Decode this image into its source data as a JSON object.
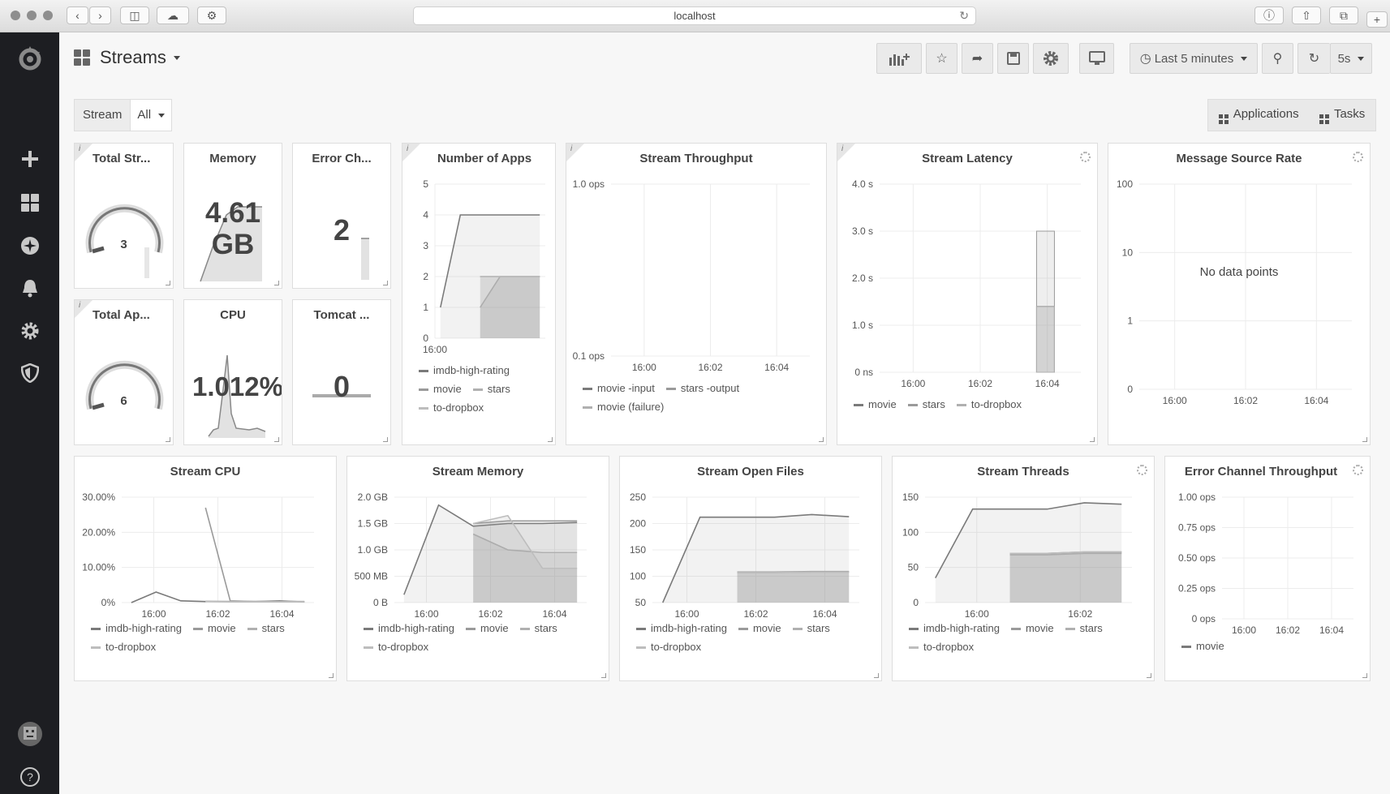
{
  "browser": {
    "url": "localhost"
  },
  "dashboard": {
    "title": "Streams"
  },
  "toolbar": {
    "time_range": "Last 5 minutes",
    "refresh": "5s"
  },
  "variables": {
    "label": "Stream",
    "value": "All"
  },
  "links": {
    "applications": "Applications",
    "tasks": "Tasks"
  },
  "info_glyph": "i",
  "panels": {
    "total_streams": {
      "title": "Total Str...",
      "value": "3"
    },
    "memory": {
      "title": "Memory",
      "value_line1": "4.61",
      "value_line2": "GB"
    },
    "error_channels": {
      "title": "Error Ch...",
      "value": "2"
    },
    "total_apps": {
      "title": "Total Ap...",
      "value": "6"
    },
    "cpu": {
      "title": "CPU",
      "value": "1.012%"
    },
    "tomcat": {
      "title": "Tomcat ...",
      "value": "0"
    },
    "number_of_apps": {
      "title": "Number of Apps"
    },
    "stream_throughput": {
      "title": "Stream Throughput"
    },
    "stream_latency": {
      "title": "Stream Latency"
    },
    "message_source_rate": {
      "title": "Message Source Rate",
      "no_data": "No data points"
    },
    "stream_cpu": {
      "title": "Stream CPU"
    },
    "stream_memory": {
      "title": "Stream Memory"
    },
    "stream_open_files": {
      "title": "Stream Open Files"
    },
    "stream_threads": {
      "title": "Stream Threads"
    },
    "error_channel_throughput": {
      "title": "Error Channel Throughput"
    }
  },
  "chart_data": [
    {
      "id": "number_of_apps",
      "type": "area",
      "x": [
        "15:59",
        "16:00",
        "16:01",
        "16:02",
        "16:03",
        "16:04"
      ],
      "xticks": [
        "16:00"
      ],
      "ylim": [
        0,
        5
      ],
      "yticks": [
        "0",
        "1",
        "2",
        "3",
        "4",
        "5"
      ],
      "series": [
        {
          "name": "imdb-high-rating",
          "values": [
            1,
            4,
            4,
            4,
            4,
            4
          ]
        },
        {
          "name": "movie",
          "values": [
            null,
            null,
            2,
            2,
            2,
            2
          ]
        },
        {
          "name": "stars",
          "values": [
            null,
            null,
            1,
            2,
            2,
            2
          ]
        },
        {
          "name": "to-dropbox",
          "values": [
            null,
            null,
            2,
            2,
            2,
            2
          ]
        }
      ],
      "legend": [
        "imdb-high-rating",
        "movie",
        "stars",
        "to-dropbox"
      ]
    },
    {
      "id": "stream_throughput",
      "type": "line",
      "xticks": [
        "16:00",
        "16:02",
        "16:04"
      ],
      "yticks": [
        "0.1 ops",
        "1.0 ops"
      ],
      "yscale": "log",
      "series": [
        {
          "name": "movie -input",
          "values": []
        },
        {
          "name": "stars -output",
          "values": []
        },
        {
          "name": "movie (failure)",
          "values": []
        }
      ],
      "legend": [
        "movie -input",
        "stars -output",
        "movie (failure)"
      ]
    },
    {
      "id": "stream_latency",
      "type": "bar",
      "xticks": [
        "16:00",
        "16:02",
        "16:04"
      ],
      "yticks": [
        "0 ns",
        "1.0 s",
        "2.0 s",
        "3.0 s",
        "4.0 s"
      ],
      "ylim": [
        0,
        4
      ],
      "series": [
        {
          "name": "movie",
          "values": [
            1.4
          ]
        },
        {
          "name": "stars",
          "values": [
            3.0
          ]
        },
        {
          "name": "to-dropbox",
          "values": [
            1.4
          ]
        }
      ],
      "legend": [
        "movie",
        "stars",
        "to-dropbox"
      ]
    },
    {
      "id": "message_source_rate",
      "type": "line",
      "xticks": [
        "16:00",
        "16:02",
        "16:04"
      ],
      "yticks": [
        "0",
        "1",
        "10",
        "100"
      ],
      "yscale": "log",
      "series": []
    },
    {
      "id": "stream_cpu",
      "type": "line",
      "xticks": [
        "16:00",
        "16:02",
        "16:04"
      ],
      "yticks": [
        "0%",
        "10.00%",
        "20.00%",
        "30.00%"
      ],
      "ylim": [
        0,
        30
      ],
      "series": [
        {
          "name": "imdb-high-rating",
          "values": [
            0,
            3,
            0.5,
            0.3,
            0.3,
            0.3,
            0.5,
            0.2
          ]
        },
        {
          "name": "movie",
          "values": [
            null,
            null,
            null,
            27,
            0.5,
            0.3,
            0.3,
            0.3
          ]
        },
        {
          "name": "stars",
          "values": [
            null,
            null,
            null,
            0.4,
            0.3,
            0.3,
            0.3,
            0.3
          ]
        },
        {
          "name": "to-dropbox",
          "values": [
            null,
            null,
            null,
            0.3,
            0.2,
            0.2,
            0.2,
            0.2
          ]
        }
      ],
      "legend": [
        "imdb-high-rating",
        "movie",
        "stars",
        "to-dropbox"
      ]
    },
    {
      "id": "stream_memory",
      "type": "area",
      "xticks": [
        "16:00",
        "16:02",
        "16:04"
      ],
      "yticks": [
        "0 B",
        "500 MB",
        "1.0 GB",
        "1.5 GB",
        "2.0 GB"
      ],
      "ylim": [
        0,
        2.0
      ],
      "series": [
        {
          "name": "imdb-high-rating",
          "values": [
            0.15,
            1.85,
            1.45,
            1.5,
            1.5,
            1.52
          ]
        },
        {
          "name": "movie",
          "values": [
            null,
            null,
            1.5,
            1.55,
            1.55,
            1.55
          ]
        },
        {
          "name": "stars",
          "values": [
            null,
            null,
            1.3,
            1.0,
            0.95,
            0.95
          ]
        },
        {
          "name": "to-dropbox",
          "values": [
            null,
            null,
            1.5,
            1.65,
            0.65,
            0.65
          ]
        }
      ],
      "legend": [
        "imdb-high-rating",
        "movie",
        "stars",
        "to-dropbox"
      ]
    },
    {
      "id": "stream_open_files",
      "type": "area",
      "xticks": [
        "16:00",
        "16:02",
        "16:04"
      ],
      "yticks": [
        "50",
        "100",
        "150",
        "200",
        "250"
      ],
      "ylim": [
        50,
        250
      ],
      "series": [
        {
          "name": "imdb-high-rating",
          "values": [
            50,
            212,
            212,
            212,
            217,
            213
          ]
        },
        {
          "name": "movie",
          "values": [
            null,
            null,
            108,
            108,
            109,
            109
          ]
        },
        {
          "name": "stars",
          "values": [
            null,
            null,
            107,
            107,
            108,
            108
          ]
        },
        {
          "name": "to-dropbox",
          "values": [
            null,
            null,
            107,
            107,
            108,
            108
          ]
        }
      ],
      "legend": [
        "imdb-high-rating",
        "movie",
        "stars",
        "to-dropbox"
      ]
    },
    {
      "id": "stream_threads",
      "type": "area",
      "xticks": [
        "16:00",
        "16:02"
      ],
      "yticks": [
        "0",
        "50",
        "100",
        "150"
      ],
      "ylim": [
        0,
        150
      ],
      "series": [
        {
          "name": "imdb-high-rating",
          "values": [
            35,
            133,
            133,
            133,
            142,
            140
          ]
        },
        {
          "name": "movie",
          "values": [
            null,
            null,
            70,
            70,
            72,
            72
          ]
        },
        {
          "name": "stars",
          "values": [
            null,
            null,
            68,
            68,
            70,
            70
          ]
        },
        {
          "name": "to-dropbox",
          "values": [
            null,
            null,
            70,
            70,
            72,
            72
          ]
        }
      ],
      "legend": [
        "imdb-high-rating",
        "movie",
        "stars",
        "to-dropbox"
      ]
    },
    {
      "id": "error_channel_throughput",
      "type": "line",
      "xticks": [
        "16:00",
        "16:02",
        "16:04"
      ],
      "yticks": [
        "0 ops",
        "0.25 ops",
        "0.50 ops",
        "0.75 ops",
        "1.00 ops"
      ],
      "ylim": [
        0,
        1
      ],
      "series": [
        {
          "name": "movie",
          "values": [
            0
          ]
        }
      ],
      "legend": [
        "movie"
      ]
    }
  ]
}
